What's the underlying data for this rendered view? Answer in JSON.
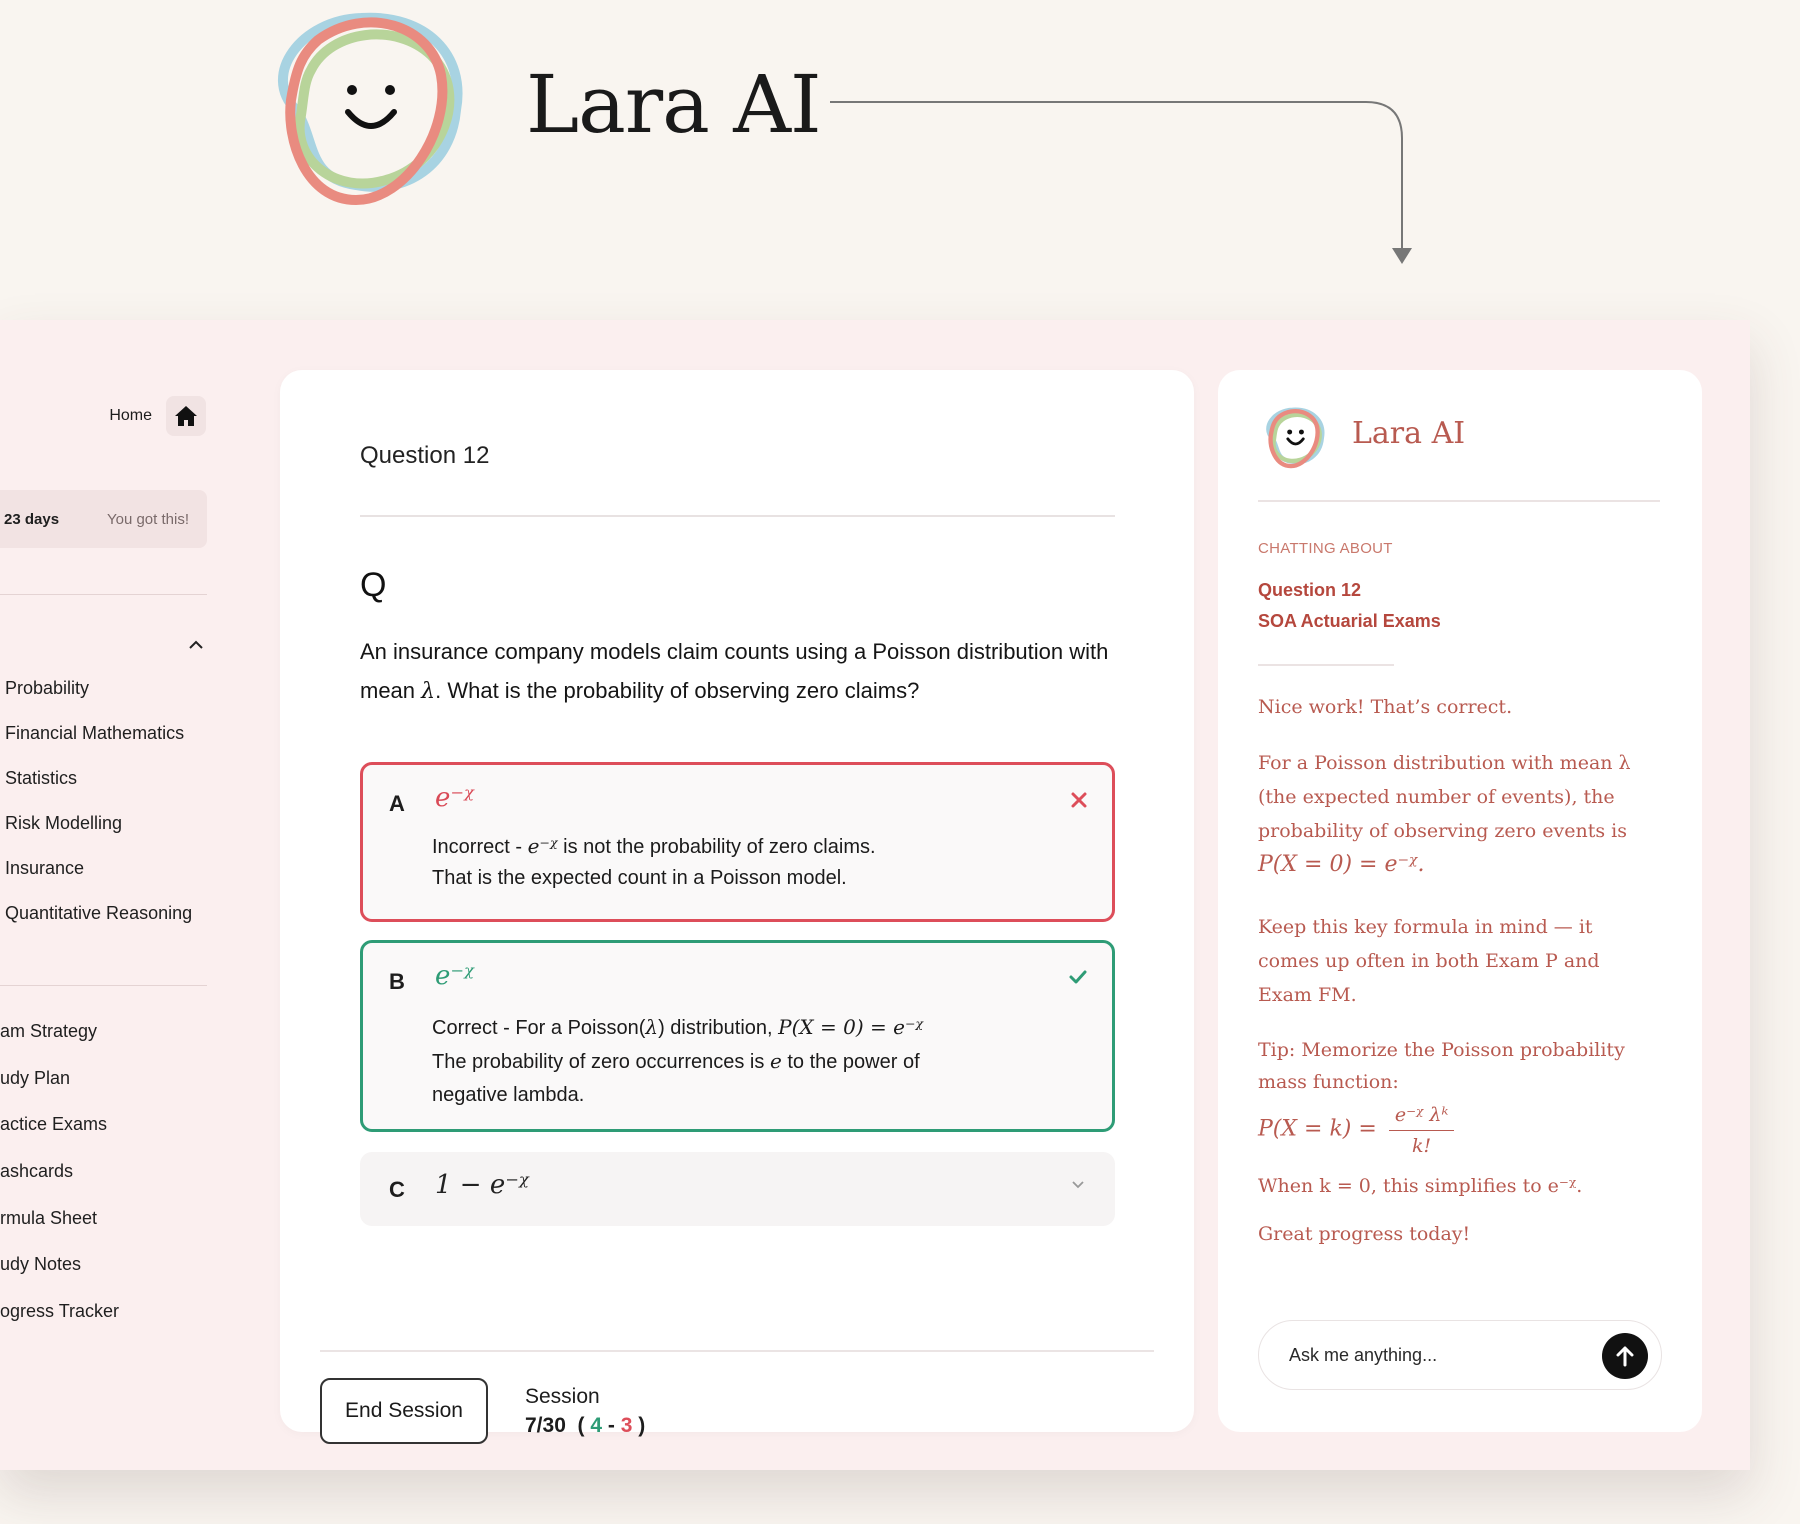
{
  "hero": {
    "title": "Lara AI"
  },
  "sidebar": {
    "home_label": "Home",
    "streak_days": "23 days",
    "streak_message": "You got this!",
    "topics": [
      "Probability",
      "Financial Mathematics",
      "Statistics",
      "Risk Modelling",
      "Insurance",
      "Quantitative Reasoning"
    ],
    "tools": [
      "am Strategy",
      "udy Plan",
      "actice Exams",
      "ashcards",
      "rmula Sheet",
      "udy Notes",
      "ogress Tracker"
    ]
  },
  "question": {
    "number_label": "Question 12",
    "q_mark": "Q",
    "text_part1": "An insurance company models claim counts using a Poisson distribution with mean ",
    "text_lambda": "λ",
    "text_part2": ". What is the probability of observing zero claims?",
    "options": [
      {
        "letter": "A",
        "value": "e⁻ᵡ",
        "status": "incorrect",
        "feedback_prefix": "Incorrect -  ",
        "feedback_math": "e⁻ᵡ",
        "feedback_line1_rest": " is not the probability of zero claims.",
        "feedback_line2": "That is the expected count in a Poisson model."
      },
      {
        "letter": "B",
        "value": "e⁻ᵡ",
        "status": "correct",
        "feedback_prefix": "Correct -  For a Poisson(",
        "feedback_lambda": "λ",
        "feedback_mid": ") distribution, ",
        "feedback_math": "P(X = 0) = e⁻ᵡ",
        "feedback_line2": "The probability of zero occurrences is ",
        "feedback_e": "e",
        "feedback_line2_rest": " to the power of",
        "feedback_line3": "negative lambda."
      },
      {
        "letter": "C",
        "value": "1 − e⁻ᵡ",
        "status": "collapsed"
      }
    ]
  },
  "footer": {
    "end_button": "End Session",
    "session_label": "Session",
    "progress": "7/30",
    "correct": "4",
    "incorrect": "3"
  },
  "chat": {
    "title": "Lara AI",
    "label": "CHATTING ABOUT",
    "context_question": "Question 12",
    "context_exam": "SOA Actuarial Exams",
    "msg1": "Nice work! That’s correct.",
    "msg2_text": "For a Poisson distribution with mean λ (the expected number of events), the probability of observing zero events is",
    "msg2_formula": "P(X = 0) = e⁻ᵡ.",
    "msg3": "Keep this key formula in mind — it comes up often in both Exam P and Exam FM.",
    "msg4": "Tip: Memorize the Poisson probability mass function:",
    "pmf_lhs": "P(X = k) =",
    "pmf_num": "e⁻ᵡ λᵏ",
    "pmf_den": "k!",
    "msg5": "When k = 0, this simplifies to e⁻ᵡ.",
    "msg6": "Great progress today!",
    "input_placeholder": "Ask me anything..."
  },
  "colors": {
    "correct": "#2e9c76",
    "incorrect": "#dd4e5a",
    "chat_text": "#b85a50",
    "frame_bg": "#fbefef",
    "page_bg": "#f9f5f0"
  }
}
